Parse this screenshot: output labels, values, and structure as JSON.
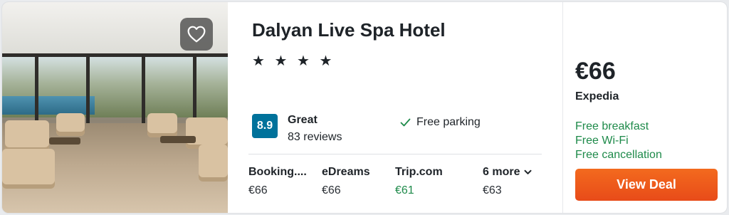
{
  "hotel": {
    "name": "Dalyan Live Spa Hotel",
    "stars_text": "★ ★ ★ ★"
  },
  "rating": {
    "score": "8.9",
    "label": "Great",
    "reviews": "83 reviews"
  },
  "amenities": [
    {
      "label": "Free parking",
      "icon": "check-icon"
    }
  ],
  "providers": [
    {
      "name": "Booking....",
      "price": "€66"
    },
    {
      "name": "eDreams",
      "price": "€66"
    },
    {
      "name": "Trip.com",
      "price": "€61"
    },
    {
      "name": "6 more",
      "price": "€63"
    }
  ],
  "deal": {
    "price": "€66",
    "provider": "Expedia",
    "perks": [
      "Free breakfast",
      "Free Wi-Fi",
      "Free cancellation"
    ],
    "button_label": "View Deal"
  },
  "colors": {
    "rating_badge": "#00729b",
    "perk_green": "#1e8a4a",
    "deal_button": "#f36a1e"
  },
  "icons": {
    "favorite": "heart-outline-icon",
    "more": "chevron-down-icon"
  }
}
